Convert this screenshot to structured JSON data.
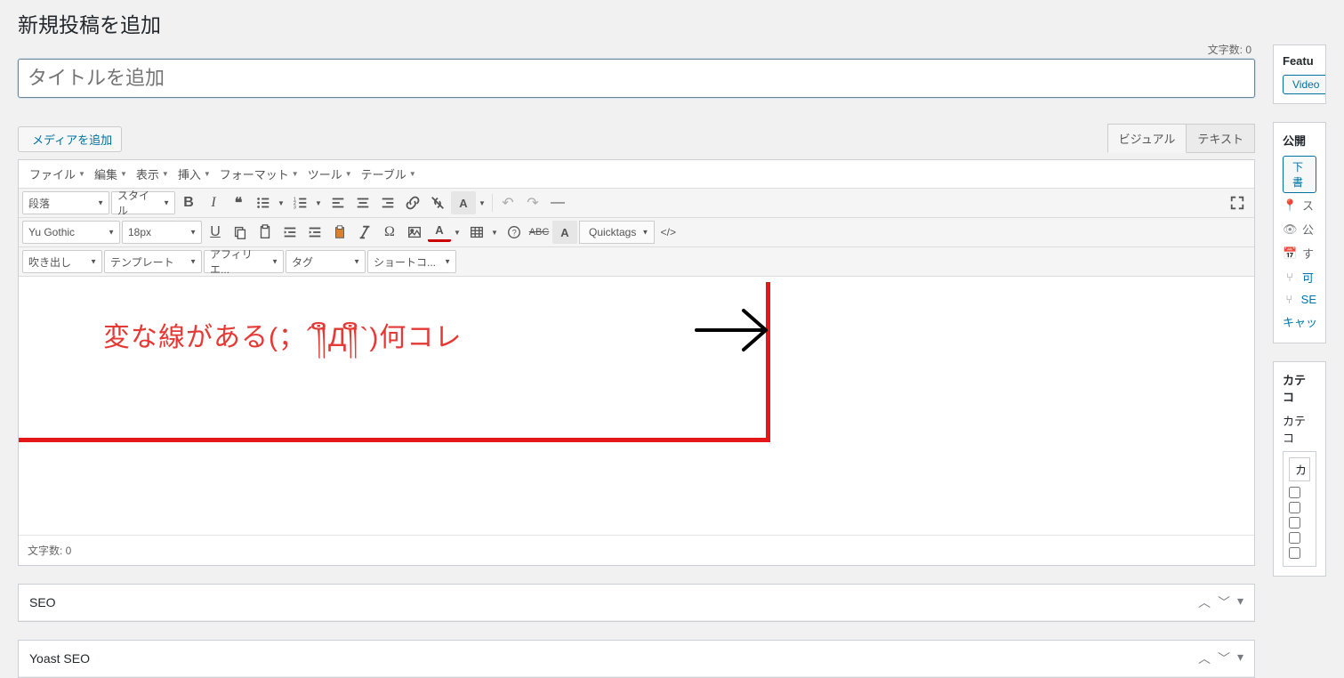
{
  "page_title": "新規投稿を追加",
  "char_count_top": "文字数: 0",
  "title_placeholder": "タイトルを追加",
  "media_button": "メディアを追加",
  "editor_tabs": {
    "visual": "ビジュアル",
    "text": "テキスト"
  },
  "menubar": {
    "file": "ファイル",
    "edit": "編集",
    "view": "表示",
    "insert": "挿入",
    "format": "フォーマット",
    "tools": "ツール",
    "table": "テーブル"
  },
  "tb1": {
    "format_sel": "段落",
    "style_sel": "スタイル"
  },
  "tb2": {
    "font_sel": "Yu Gothic",
    "size_sel": "18px",
    "quicktags": "Quicktags"
  },
  "tb3": {
    "balloon": "吹き出し",
    "template": "テンプレート",
    "affiliate": "アフィリエ...",
    "tag": "タグ",
    "shortcode": "ショートコ..."
  },
  "annotation_text": "変な線がある(；´༎ຶД༎ຶ`)何コレ",
  "status_bar": "文字数: 0",
  "postboxes": {
    "seo": "SEO",
    "yoast": "Yoast SEO"
  },
  "sidebar": {
    "featured": "Featu",
    "video_btn": "Video",
    "publish": "公開",
    "draft_btn": "下書",
    "status": "ス",
    "visibility": "公",
    "schedule": "す",
    "readability": "可",
    "seo": "SE",
    "cache": "キャッ",
    "cat": "カテコ",
    "cat_tab": "カテコ",
    "cat_sel": "カ"
  }
}
